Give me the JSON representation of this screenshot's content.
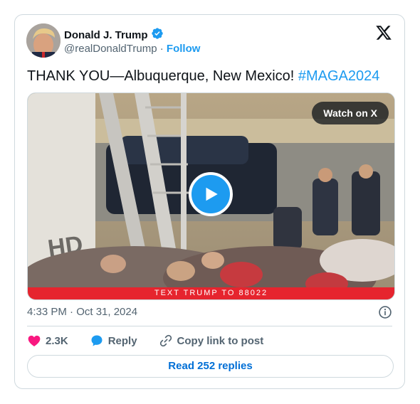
{
  "author": {
    "name": "Donald J. Trump",
    "handle": "@realDonaldTrump",
    "separator": "·",
    "follow_label": "Follow"
  },
  "tweet": {
    "text": "THANK YOU—Albuquerque, New Mexico! ",
    "hashtag": "#MAGA2024",
    "timestamp": "4:33 PM · Oct 31, 2024"
  },
  "media": {
    "watch_label": "Watch on X",
    "banner_text": "TEXT TRUMP TO 88022"
  },
  "actions": {
    "likes": "2.3K",
    "reply_label": "Reply",
    "copy_label": "Copy link to post"
  },
  "replies_button": "Read 252 replies",
  "icons": {
    "verified": "verified-badge-icon",
    "x_logo": "x-logo-icon",
    "info": "info-icon",
    "heart": "heart-icon",
    "reply": "reply-bubble-icon",
    "link": "link-icon",
    "play": "play-icon"
  },
  "colors": {
    "accent": "#1d9bf0",
    "heart": "#f91880",
    "banner": "#e6242e",
    "secondary_text": "#536471"
  }
}
